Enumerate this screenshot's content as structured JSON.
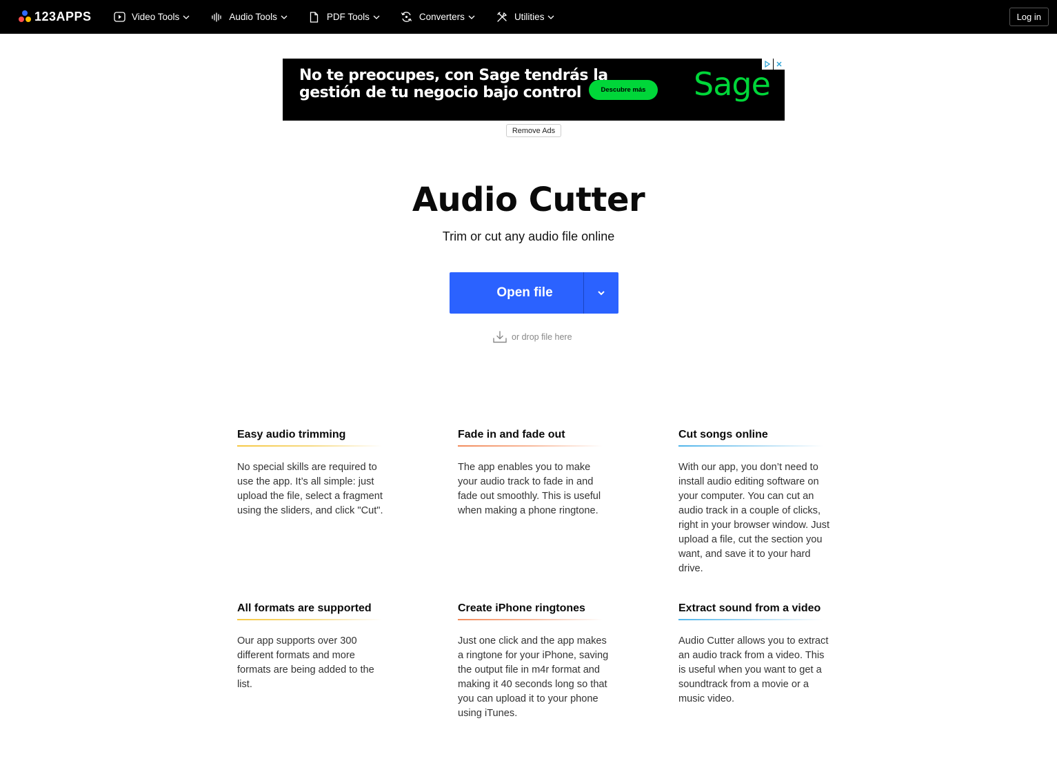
{
  "header": {
    "logo_text": "123APPS",
    "nav": [
      {
        "label": "Video Tools",
        "icon": "play-icon"
      },
      {
        "label": "Audio Tools",
        "icon": "waveform-icon"
      },
      {
        "label": "PDF Tools",
        "icon": "document-icon"
      },
      {
        "label": "Converters",
        "icon": "convert-icon"
      },
      {
        "label": "Utilities",
        "icon": "tools-icon"
      }
    ],
    "login_label": "Log in"
  },
  "ad": {
    "line1": "No te preocupes, con Sage tendrás la",
    "line2": "gestión de tu negocio bajo control",
    "cta": "Descubre más",
    "brand": "Sage",
    "remove_label": "Remove Ads"
  },
  "hero": {
    "title": "Audio Cutter",
    "subtitle": "Trim or cut any audio file online",
    "open_label": "Open file",
    "drop_hint": "or drop file here"
  },
  "features": [
    {
      "title": "Easy audio trimming",
      "text": "No special skills are required to use the app. It’s all simple: just upload the file, select a fragment using the sliders, and click \"Cut\"."
    },
    {
      "title": "Fade in and fade out",
      "text": "The app enables you to make your audio track to fade in and fade out smoothly. This is useful when making a phone ringtone."
    },
    {
      "title": "Cut songs online",
      "text": "With our app, you don’t need to install audio editing software on your computer. You can cut an audio track in a couple of clicks, right in your browser window. Just upload a file, cut the section you want, and save it to your hard drive."
    },
    {
      "title": "All formats are supported",
      "text": "Our app supports over 300 different formats and more formats are being added to the list."
    },
    {
      "title": "Create iPhone ringtones",
      "text": "Just one click and the app makes a ringtone for your iPhone, saving the output file in m4r format and making it 40 seconds long so that you can upload it to your phone using iTunes."
    },
    {
      "title": "Extract sound from a video",
      "text": "Audio Cutter allows you to extract an audio track from a video. This is useful when you want to get a soundtrack from a movie or a music video."
    }
  ],
  "colors": {
    "accent": "#2b62ff",
    "ad_green": "#00d639",
    "line_yellow": "#f6c842",
    "line_orange": "#f28a5a",
    "line_blue": "#4fb4ea"
  }
}
